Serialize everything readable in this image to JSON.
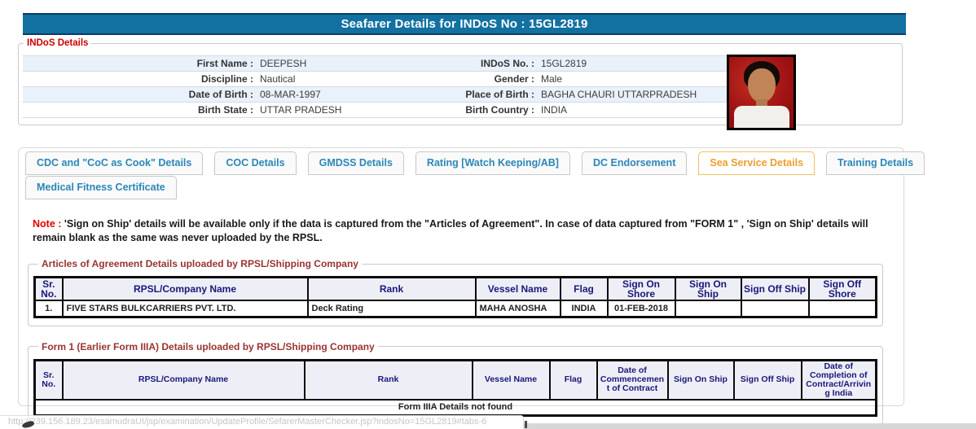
{
  "header": {
    "title": "Seafarer Details for INDoS No : 15GL2819"
  },
  "indos": {
    "legend": "INDoS Details",
    "rows": [
      {
        "l1": "First Name :",
        "v1": "DEEPESH",
        "l2": "INDoS No. :",
        "v2": "15GL2819"
      },
      {
        "l1": "Discipline :",
        "v1": "Nautical",
        "l2": "Gender :",
        "v2": "Male"
      },
      {
        "l1": "Date of Birth :",
        "v1": "08-MAR-1997",
        "l2": "Place of Birth :",
        "v2": "BAGHA CHAURI UTTARPRADESH"
      },
      {
        "l1": "Birth State :",
        "v1": "UTTAR PRADESH",
        "l2": "Birth Country :",
        "v2": "INDIA"
      }
    ],
    "photo": "seafarer passport photo, red background"
  },
  "tabs": {
    "items": [
      {
        "label": "CDC and \"CoC as Cook\" Details",
        "active": false
      },
      {
        "label": "COC Details",
        "active": false
      },
      {
        "label": "GMDSS Details",
        "active": false
      },
      {
        "label": "Rating [Watch Keeping/AB]",
        "active": false
      },
      {
        "label": "DC Endorsement",
        "active": false
      },
      {
        "label": "Sea Service Details",
        "active": true
      },
      {
        "label": "Training Details",
        "active": false
      },
      {
        "label": "Medical Fitness Certificate",
        "active": false
      }
    ]
  },
  "note": {
    "prefix": "Note : ",
    "body": "'Sign on Ship' details will be available only if the data is captured from the \"Articles of Agreement\". In case of data captured from \"FORM 1\" , 'Sign on Ship' details will remain blank as the same was never uploaded by the RPSL."
  },
  "articles": {
    "legend": "Articles of Agreement Details uploaded by RPSL/Shipping Company",
    "headers": [
      "Sr. No.",
      "RPSL/Company Name",
      "Rank",
      "Vessel Name",
      "Flag",
      "Sign On Shore",
      "Sign On Ship",
      "Sign Off Ship",
      "Sign Off Shore"
    ],
    "rows": [
      [
        "1.",
        "FIVE STARS BULKCARRIERS PVT. LTD.",
        "Deck Rating",
        "MAHA ANOSHA",
        "INDIA",
        "01-FEB-2018",
        "",
        "",
        ""
      ]
    ]
  },
  "form1": {
    "legend": "Form 1 (Earlier Form IIIA) Details uploaded by RPSL/Shipping Company",
    "headers": [
      "Sr. No.",
      "RPSL/Company Name",
      "Rank",
      "Vessel Name",
      "Flag",
      "Date of Commencement of Contract",
      "Sign On Ship",
      "Sign Off Ship",
      "Date of Completion of Contract/Arriving India"
    ],
    "empty_message": "Form IIIA Details not found"
  },
  "statusbar": {
    "url": "http://239.156.189.23/esamudraUI/jsp/examination/UpdateProfile/SefarerMasterChecker.jsp?indosNo=15GL2819#tabs-6"
  },
  "colors": {
    "header_bar": "#1371a1",
    "tab_link": "#2b87b8",
    "tab_active": "#ee9d2e",
    "section_label": "#993333",
    "alert_red": "#e60000",
    "table_header_text": "#18187a",
    "row_alt_bg": "#e9f1fa"
  }
}
